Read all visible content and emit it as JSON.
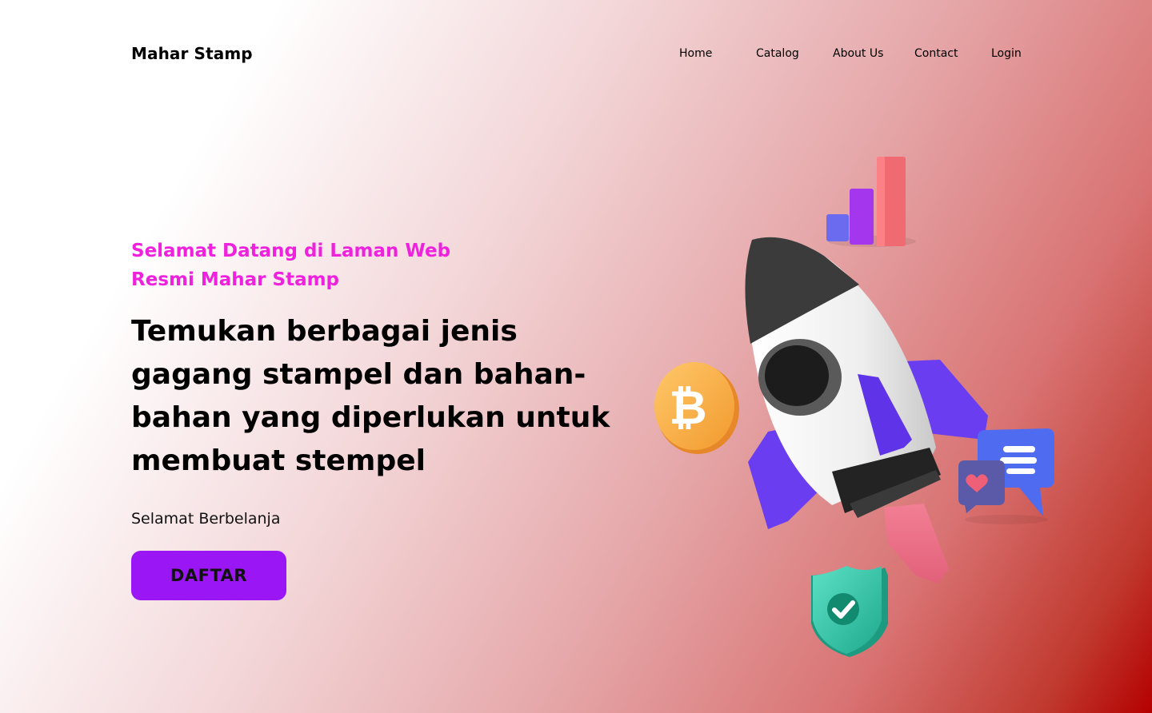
{
  "header": {
    "brand": "Mahar Stamp",
    "nav": [
      "Home",
      "Catalog",
      "About Us",
      "Contact",
      "Login"
    ]
  },
  "hero": {
    "welcome_line1": "Selamat Datang di Laman Web",
    "welcome_line2": "Resmi Mahar Stamp",
    "headline": "Temukan berbagai jenis gagang stampel dan bahan-bahan yang diperlukan untuk membuat stempel",
    "subtitle": "Selamat Berbelanja",
    "cta_label": "DAFTAR"
  },
  "illustration": {
    "icons": [
      "rocket-icon",
      "bitcoin-coin-icon",
      "bar-chart-icon",
      "chat-bubble-icon",
      "heart-bubble-icon",
      "shield-check-icon"
    ]
  },
  "colors": {
    "accent": "#9b16f5",
    "welcome_text": "#ee22dd",
    "gradient_end": "#b40000"
  }
}
